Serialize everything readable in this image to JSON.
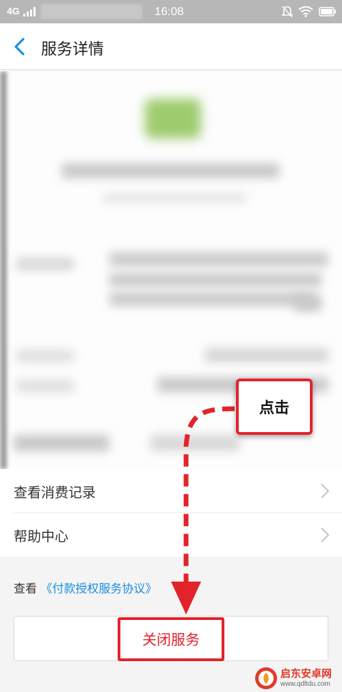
{
  "status_bar": {
    "carrier": "4G",
    "time": "16:08"
  },
  "nav": {
    "title": "服务详情"
  },
  "menu": {
    "items": [
      {
        "label": "查看消费记录"
      },
      {
        "label": "帮助中心"
      }
    ]
  },
  "agreement": {
    "prefix": "查看",
    "link_text": "《付款授权服务协议》"
  },
  "close_service": {
    "label": "关闭服务"
  },
  "callout": {
    "text": "点击"
  },
  "watermark": {
    "name": "启东安卓网",
    "url": "www.qdltdu.com"
  },
  "colors": {
    "accent": "#1a8ee0",
    "highlight": "#e2232a"
  }
}
